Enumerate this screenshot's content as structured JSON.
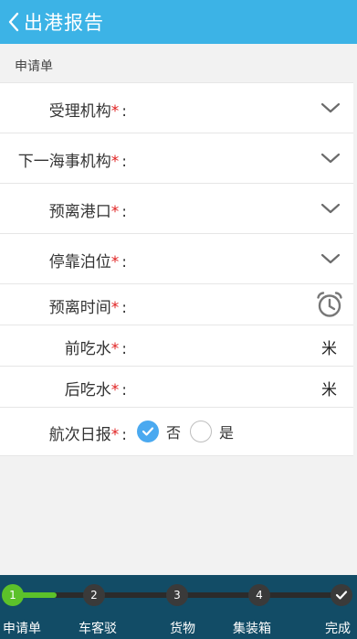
{
  "header": {
    "title": "出港报告"
  },
  "section": {
    "label": "申请单"
  },
  "form": {
    "required_mark": "*",
    "colon": ":",
    "fields": [
      {
        "label": "受理机构"
      },
      {
        "label": "下一海事机构"
      },
      {
        "label": "预离港口"
      },
      {
        "label": "停靠泊位"
      },
      {
        "label": "预离时间"
      },
      {
        "label": "前吃水",
        "unit": "米"
      },
      {
        "label": "后吃水",
        "unit": "米"
      },
      {
        "label": "航次日报",
        "options": [
          "否",
          "是"
        ],
        "selected": "否"
      }
    ]
  },
  "progress": {
    "steps": [
      {
        "number": "1",
        "label": "申请单"
      },
      {
        "number": "2",
        "label": "车客驳"
      },
      {
        "number": "3",
        "label": "货物"
      },
      {
        "number": "4",
        "label": "集装箱"
      },
      {
        "number": "",
        "label": "完成"
      }
    ],
    "current": 1
  },
  "colors": {
    "header": "#3cb3e6",
    "footer": "#124c66",
    "active_step": "#5cc12a",
    "required": "#e02020",
    "radio_selected": "#4aa9f0"
  },
  "icons": {
    "back": "chevron-left-icon",
    "dropdown": "chevron-down-icon",
    "time": "alarm-clock-icon",
    "done": "check-icon"
  }
}
